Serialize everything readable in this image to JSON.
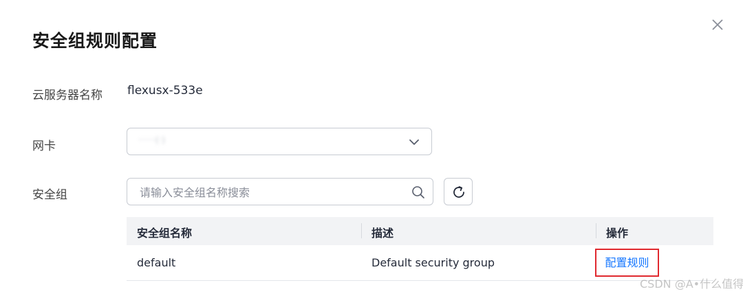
{
  "dialog": {
    "title": "安全组规则配置"
  },
  "form": {
    "server_name_label": "云服务器名称",
    "server_name_value": "flexusx-533e",
    "nic_label": "网卡",
    "nic_value": "······(·)",
    "security_group_label": "安全组",
    "search_placeholder": "请输入安全组名称搜索"
  },
  "table": {
    "columns": [
      "安全组名称",
      "描述",
      "操作"
    ],
    "rows": [
      {
        "name": "default",
        "description": "Default security group",
        "action": "配置规则"
      }
    ]
  },
  "watermark": "CSDN @A•什么值得买",
  "colors": {
    "link": "#1476ff",
    "highlight_box": "#e0282e",
    "header_bg": "#f2f3f5"
  }
}
